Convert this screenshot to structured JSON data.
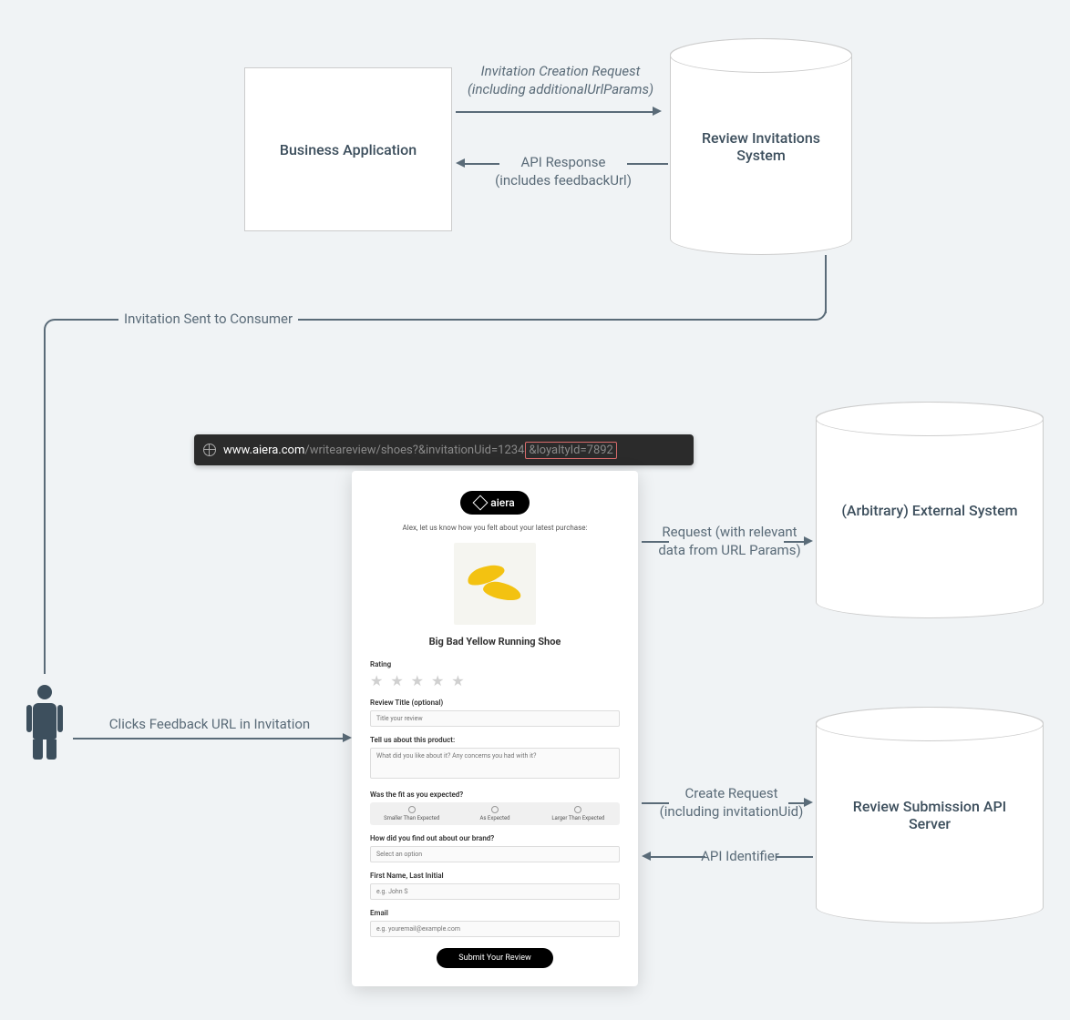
{
  "nodes": {
    "business_app": "Business Application",
    "review_invitations": "Review Invitations\nSystem",
    "external_system": "(Arbitrary) External System",
    "review_api_server": "Review Submission API\nServer"
  },
  "edges": {
    "creation_request": "Invitation Creation Request\n(including additionalUrlParams)",
    "api_response": "API Response\n(includes feedbackUrl)",
    "invitation_sent": "Invitation Sent to Consumer",
    "clicks_feedback": "Clicks Feedback URL in Invitation",
    "request_external": "Request (with relevant\ndata from URL Params)",
    "create_request": "Create Request\n(including invitationUid)",
    "api_identifier": "API Identifier"
  },
  "url": {
    "domain": "www.aiera.com",
    "path": "/writeareview/shoes?&invitationUid=1234",
    "highlight": "&loyaltyId=7892"
  },
  "form": {
    "logo": "aiera",
    "greeting": "Alex, let us know how you felt about your latest purchase:",
    "product_title": "Big Bad Yellow Running Shoe",
    "rating_label": "Rating",
    "review_title_label": "Review Title (optional)",
    "review_title_placeholder": "Title your review",
    "tell_us_label": "Tell us about this product:",
    "tell_us_placeholder": "What did you like about it? Any concerns you had with it?",
    "fit_label": "Was the fit as you expected?",
    "fit_options": [
      "Smaller Than Expected",
      "As Expected",
      "Larger Than Expected"
    ],
    "brand_label": "How did you find out about our brand?",
    "brand_placeholder": "Select an option",
    "name_label": "First Name, Last Initial",
    "name_placeholder": "e.g. John S",
    "email_label": "Email",
    "email_placeholder": "e.g. youremail@example.com",
    "submit": "Submit Your Review"
  }
}
